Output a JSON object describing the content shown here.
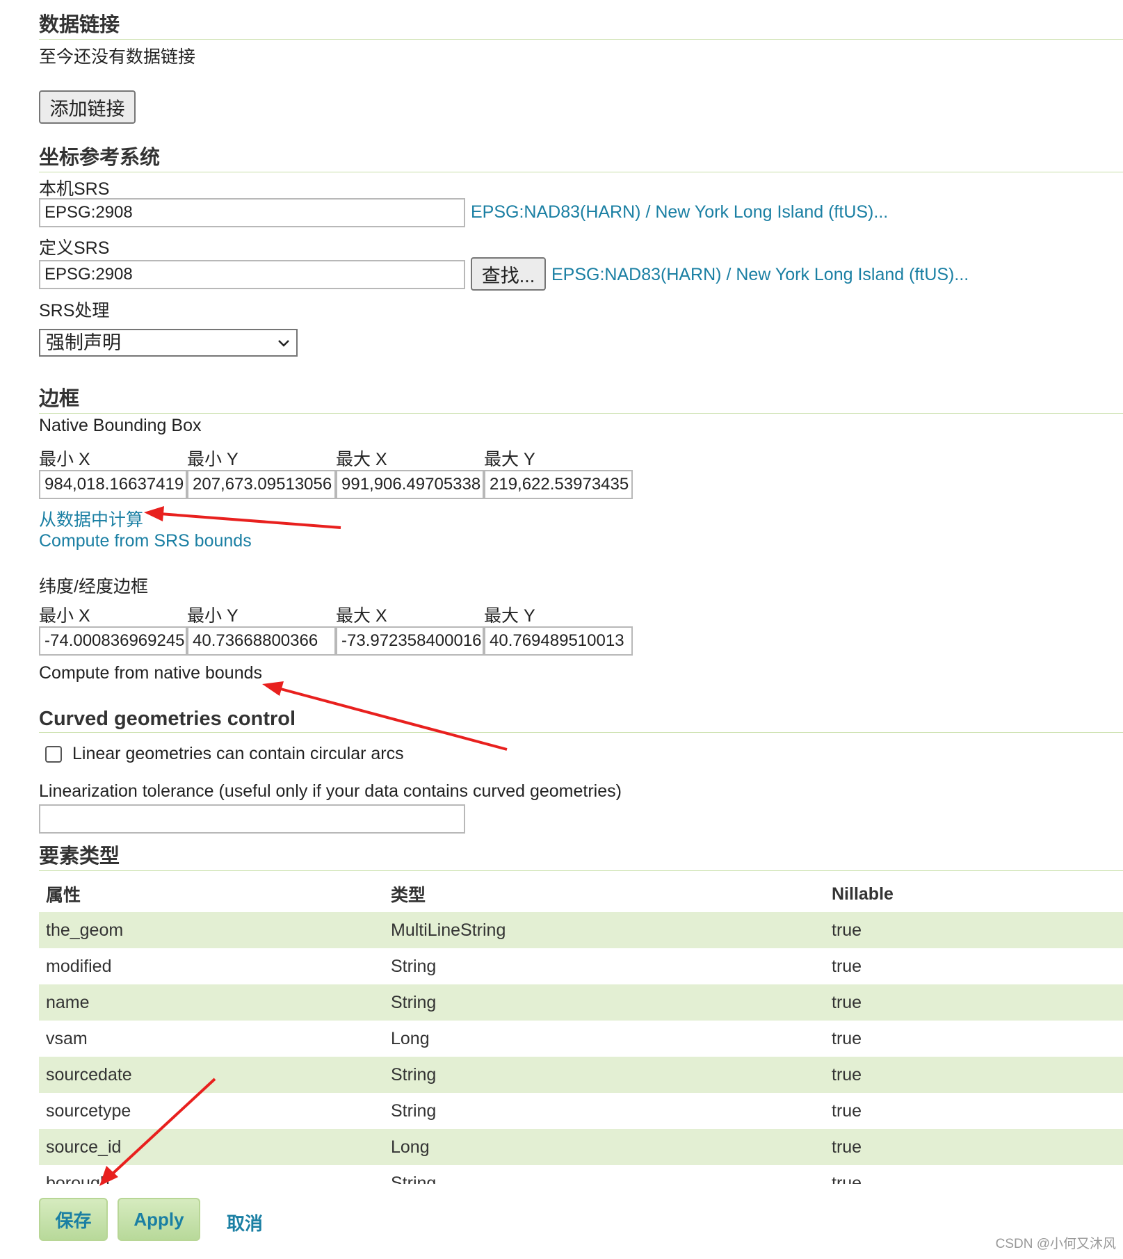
{
  "data_links": {
    "title": "数据链接",
    "empty_text": "至今还没有数据链接",
    "add_button": "添加链接"
  },
  "crs": {
    "title": "坐标参考系统",
    "native_label": "本机SRS",
    "native_value": "EPSG:2908",
    "native_link": "EPSG:NAD83(HARN) / New York Long Island (ftUS)...",
    "declared_label": "定义SRS",
    "declared_value": "EPSG:2908",
    "find_button": "查找...",
    "declared_link": "EPSG:NAD83(HARN) / New York Long Island (ftUS)...",
    "handling_label": "SRS处理",
    "handling_value": "强制声明"
  },
  "bbox": {
    "title": "边框",
    "native_label": "Native Bounding Box",
    "col_minx": "最小 X",
    "col_miny": "最小 Y",
    "col_maxx": "最大 X",
    "col_maxy": "最大 Y",
    "native_minx": "984,018.16637419",
    "native_miny": "207,673.09513056",
    "native_maxx": "991,906.49705338",
    "native_maxy": "219,622.53973435",
    "compute_from_data": "从数据中计算",
    "compute_from_srs": "Compute from SRS bounds",
    "latlon_label": "纬度/经度边框",
    "latlon_minx": "-74.000836969245",
    "latlon_miny": "40.73668800366",
    "latlon_maxx": "-73.972358400016",
    "latlon_maxy": "40.769489510013",
    "compute_from_native": "Compute from native bounds"
  },
  "curved": {
    "title": "Curved geometries control",
    "checkbox_label": "Linear geometries can contain circular arcs",
    "tolerance_label": "Linearization tolerance (useful only if your data contains curved geometries)",
    "tolerance_value": ""
  },
  "feature_type": {
    "title": "要素类型",
    "headers": [
      "属性",
      "类型",
      "Nillable"
    ],
    "rows": [
      {
        "name": "the_geom",
        "type": "MultiLineString",
        "nillable": "true"
      },
      {
        "name": "modified",
        "type": "String",
        "nillable": "true"
      },
      {
        "name": "name",
        "type": "String",
        "nillable": "true"
      },
      {
        "name": "vsam",
        "type": "Long",
        "nillable": "true"
      },
      {
        "name": "sourcedate",
        "type": "String",
        "nillable": "true"
      },
      {
        "name": "sourcetype",
        "type": "String",
        "nillable": "true"
      },
      {
        "name": "source_id",
        "type": "Long",
        "nillable": "true"
      },
      {
        "name": "borough",
        "type": "String",
        "nillable": "true"
      }
    ]
  },
  "footer": {
    "save": "保存",
    "apply": "Apply",
    "cancel": "取消"
  },
  "watermark": "CSDN @小何又沐风",
  "colors": {
    "link": "#1a7fa3",
    "rule": "#c8dfa8",
    "row_stripe": "#e3efd3",
    "button_green": "#c6e2a8",
    "annotation_arrow": "#e8201e"
  }
}
